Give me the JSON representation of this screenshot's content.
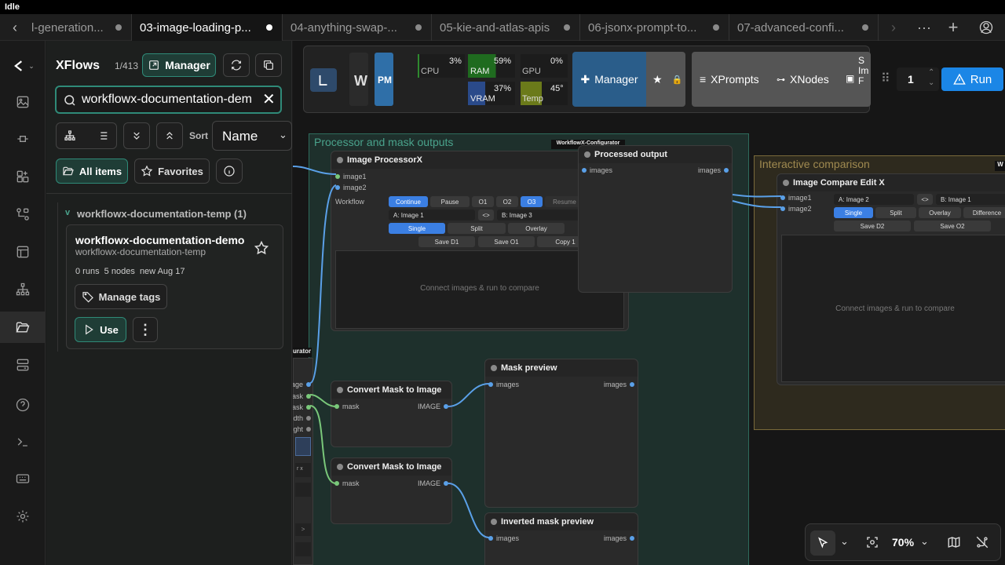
{
  "titlebar": {
    "title": "Idle"
  },
  "tabs": [
    {
      "label": "l-generation..."
    },
    {
      "label": "03-image-loading-p..."
    },
    {
      "label": "04-anything-swap-..."
    },
    {
      "label": "05-kie-and-atlas-apis"
    },
    {
      "label": "06-jsonx-prompt-to..."
    },
    {
      "label": "07-advanced-confi..."
    }
  ],
  "tabbar_icons": {
    "back": "chevron-left-icon",
    "forward": "chevron-right-icon",
    "more": "ellipsis-icon",
    "add": "plus-icon",
    "user": "user-icon"
  },
  "panel": {
    "title": "XFlows",
    "count": "1/413",
    "manager_label": "Manager",
    "search_value": "workflowx-documentation-dem",
    "sort_label": "Sort",
    "sort_value": "Name",
    "all_items_label": "All items",
    "favorites_label": "Favorites",
    "folder_label": "workflowx-documentation-temp (1)",
    "folder_chevron": "v",
    "card": {
      "title": "workflowx-documentation-demo",
      "subtitle": "workflowx-documentation-temp",
      "meta": "0 runs  5 nodes  new Aug 17",
      "manage_tags_label": "Manage tags",
      "use_label": "Use"
    }
  },
  "topbar": {
    "logo_letter": "W",
    "pm_label": "PM",
    "cpu_label": "CPU",
    "cpu_value": "3%",
    "ram_label": "RAM",
    "ram_value": "59%",
    "gpu_label": "GPU",
    "gpu_value": "0%",
    "vram_label": "VRAM",
    "vram_value": "37%",
    "temp_label": "Temp",
    "temp_value": "45°",
    "manager_label": "Manager",
    "xprompts_label": "XPrompts",
    "xnodes_label": "XNodes",
    "clip_label": "S Im F",
    "queue_value": "1",
    "run_label": "Run"
  },
  "groups": {
    "processor": "Processor and mask outputs",
    "interactive": "Interactive comparison",
    "configurator_badge": "WorkflowX-Configurator",
    "configurator_side_badge": "urator",
    "interactive_badge": "W"
  },
  "nodes": {
    "processor": {
      "title": "Image ProcessorX",
      "in1": "image1",
      "in2": "image2",
      "workflow_label": "Workflow",
      "btn_continue": "Continue",
      "btn_pause": "Pause",
      "btn_o1": "O1",
      "btn_o2": "O2",
      "btn_o3": "O3",
      "btn_resume": "Resume",
      "sel_a": "A: Image 1",
      "swap": "<>",
      "sel_b": "B: Image 3",
      "mode_single": "Single",
      "mode_split": "Split",
      "mode_overlay": "Overlay",
      "save_d1": "Save D1",
      "save_o1": "Save O1",
      "copy1": "Copy 1",
      "placeholder": "Connect images & run to compare"
    },
    "processed_output": {
      "title": "Processed output",
      "in": "images",
      "out": "images"
    },
    "compare": {
      "title": "Image Compare Edit X",
      "in1": "image1",
      "in2": "image2",
      "sel_a": "A: Image 2",
      "swap": "<>",
      "sel_b": "B: Image 1",
      "mode_single": "Single",
      "mode_split": "Split",
      "mode_overlay": "Overlay",
      "mode_difference": "Difference",
      "save_d2": "Save D2",
      "save_o2": "Save O2",
      "placeholder": "Connect images & run to compare"
    },
    "mask_to_image_1": {
      "title": "Convert Mask to Image",
      "in": "mask",
      "out": "IMAGE"
    },
    "mask_to_image_2": {
      "title": "Convert Mask to Image",
      "in": "mask",
      "out": "IMAGE"
    },
    "mask_preview": {
      "title": "Mask preview",
      "in": "images",
      "out": "images"
    },
    "inverted_mask_preview": {
      "title": "Inverted mask preview",
      "in": "images",
      "out": "images"
    },
    "left_partial": {
      "p1": "age",
      "p2": "ask",
      "p3": "ask",
      "p4": "dth",
      "p5": "ght",
      "w1": "r x",
      "w2": ">"
    }
  },
  "bottom_toolbar": {
    "zoom_value": "70%"
  }
}
